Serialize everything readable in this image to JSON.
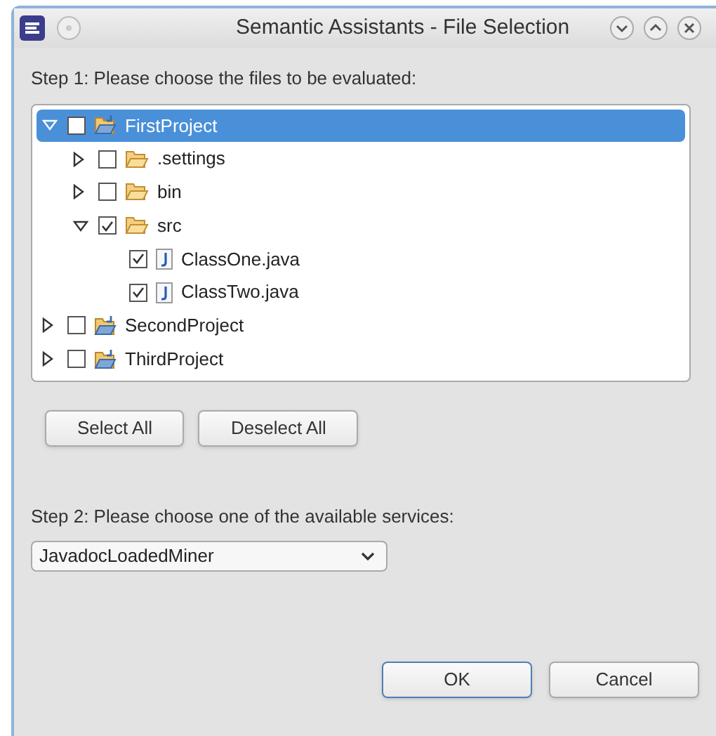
{
  "window": {
    "title": "Semantic Assistants - File Selection"
  },
  "step1_label": "Step 1: Please choose the files to be evaluated:",
  "tree": [
    {
      "label": "FirstProject",
      "kind": "project",
      "expanded": true,
      "checked": false,
      "selected": true,
      "children": [
        {
          "label": ".settings",
          "kind": "folder",
          "expanded": false,
          "checked": false,
          "selected": false
        },
        {
          "label": "bin",
          "kind": "folder",
          "expanded": false,
          "checked": false,
          "selected": false
        },
        {
          "label": "src",
          "kind": "folder",
          "expanded": true,
          "checked": true,
          "selected": false,
          "children": [
            {
              "label": "ClassOne.java",
              "kind": "file",
              "checked": true,
              "selected": false
            },
            {
              "label": "ClassTwo.java",
              "kind": "file",
              "checked": true,
              "selected": false
            }
          ]
        }
      ]
    },
    {
      "label": "SecondProject",
      "kind": "project",
      "expanded": false,
      "checked": false,
      "selected": false
    },
    {
      "label": "ThirdProject",
      "kind": "project",
      "expanded": false,
      "checked": false,
      "selected": false
    }
  ],
  "selection_buttons": [
    "Select All",
    "Deselect All"
  ],
  "step2_label": "Step 2: Please choose one of the available services:",
  "service_dropdown": {
    "value": "JavadocLoadedMiner"
  },
  "dialog_buttons": [
    {
      "label": "OK",
      "default": true
    },
    {
      "label": "Cancel",
      "default": false
    }
  ]
}
